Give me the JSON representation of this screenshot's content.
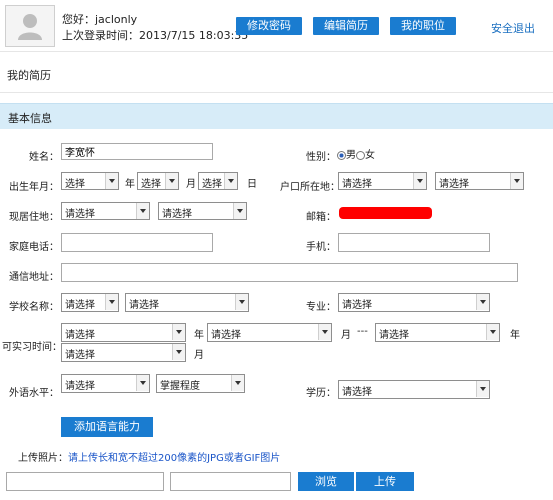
{
  "header": {
    "greeting": "您好：",
    "username": "jaclonly",
    "last_login": "上次登录时间：2013/7/15 18:03:35",
    "buttons": {
      "change_password": "修改密码",
      "edit_resume": "编辑简历",
      "my_jobs": "我的职位"
    },
    "logout": "安全退出"
  },
  "page_title": "我的简历",
  "section_title": "基本信息",
  "form": {
    "name": {
      "label": "姓名：",
      "value": "李宽怀"
    },
    "gender": {
      "label": "性别：",
      "options": [
        "男",
        "女"
      ],
      "selected": "男"
    },
    "birth": {
      "label": "出生年月：",
      "year": "选择",
      "month": "选择",
      "day": "选择",
      "u_year": "年",
      "u_month": "月",
      "u_day": "日"
    },
    "hukou": {
      "label": "户口所在地：",
      "province": "请选择",
      "city": "请选择"
    },
    "residence": {
      "label": "现居住地：",
      "province": "请选择",
      "city": "请选择"
    },
    "email": {
      "label": "邮箱："
    },
    "home_phone": {
      "label": "家庭电话：",
      "value": ""
    },
    "mobile": {
      "label": "手机：",
      "value": ""
    },
    "address": {
      "label": "通信地址：",
      "value": ""
    },
    "school": {
      "label": "学校名称：",
      "province": "请选择",
      "school": "请选择"
    },
    "major": {
      "label": "专业：",
      "value": "请选择"
    },
    "intern": {
      "label": "可实习时间：",
      "start_year": "请选择",
      "u_year": "年",
      "start_month": "请选择",
      "u_month": "月",
      "dash": "---",
      "end_year": "请选择",
      "end_month": "请选择",
      "u_year2": "年",
      "u_month2": "月"
    },
    "language": {
      "label": "外语水平：",
      "lang": "请选择",
      "level": "掌握程度"
    },
    "education": {
      "label": "学历：",
      "value": "请选择"
    },
    "add_language": "添加语言能力",
    "photo": {
      "label": "上传照片：",
      "hint": "请上传长和宽不超过200像素的JPG或者GIF图片"
    },
    "browse": "浏览",
    "upload": "上传"
  }
}
